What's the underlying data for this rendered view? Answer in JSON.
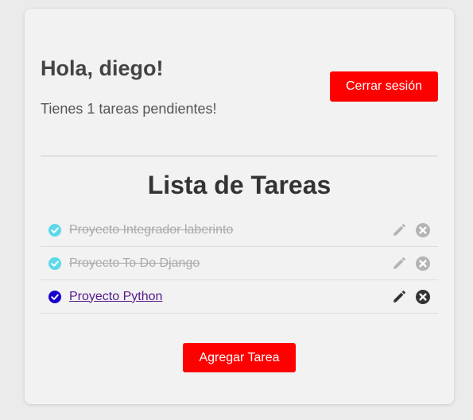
{
  "header": {
    "greeting": "Hola, diego!",
    "pending_message": "Tienes 1 tareas pendientes!",
    "logout_label": "Cerrar sesión"
  },
  "list": {
    "title": "Lista de Tareas",
    "tasks": [
      {
        "text": "Proyecto Integrador laberinto",
        "completed": true
      },
      {
        "text": "Proyecto To Do Django",
        "completed": true
      },
      {
        "text": "Proyecto Python",
        "completed": false
      }
    ]
  },
  "add_task_label": "Agregar Tarea",
  "colors": {
    "accent_button": "#ff0000",
    "done_check": "#5ed8ea",
    "pending_check": "#1500cc",
    "muted_icon": "#b4b4b4",
    "active_icon": "#333333"
  },
  "icons": {
    "check": "check-circle-icon",
    "edit": "pencil-icon",
    "delete": "x-circle-icon"
  }
}
